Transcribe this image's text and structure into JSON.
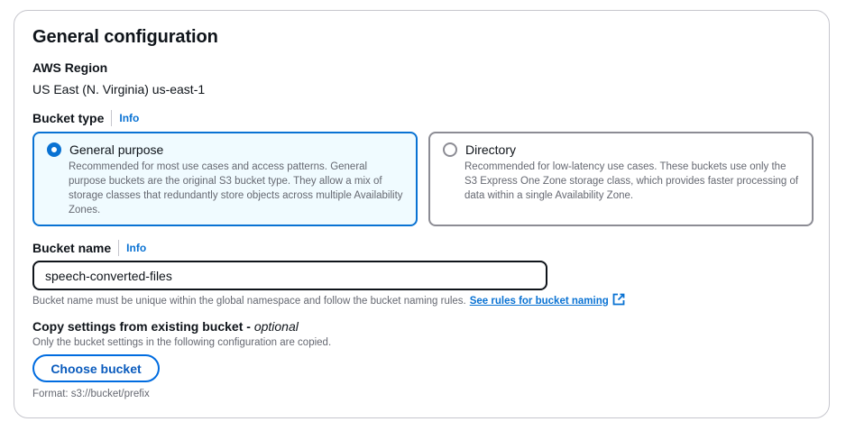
{
  "section": {
    "title": "General configuration"
  },
  "region": {
    "label": "AWS Region",
    "value": "US East (N. Virginia) us-east-1"
  },
  "bucket_type": {
    "label": "Bucket type",
    "info": "Info",
    "options": [
      {
        "title": "General purpose",
        "description": "Recommended for most use cases and access patterns. General purpose buckets are the original S3 bucket type. They allow a mix of storage classes that redundantly store objects across multiple Availability Zones.",
        "selected": true
      },
      {
        "title": "Directory",
        "description": "Recommended for low-latency use cases. These buckets use only the S3 Express One Zone storage class, which provides faster processing of data within a single Availability Zone.",
        "selected": false
      }
    ]
  },
  "bucket_name": {
    "label": "Bucket name",
    "info": "Info",
    "value": "speech-converted-files",
    "hint": "Bucket name must be unique within the global namespace and follow the bucket naming rules.",
    "rules_link": "See rules for bucket naming",
    "rules_link_icon": "external-link-icon"
  },
  "copy_settings": {
    "label": "Copy settings from existing bucket - ",
    "optional": "optional",
    "hint": "Only the bucket settings in the following configuration are copied.",
    "button": "Choose bucket",
    "format": "Format: s3://bucket/prefix"
  },
  "colors": {
    "accent": "#0972d3",
    "selected_bg": "#f0fbff",
    "border": "#c6c6cd",
    "text": "#0f141a",
    "secondary_text": "#656871"
  }
}
